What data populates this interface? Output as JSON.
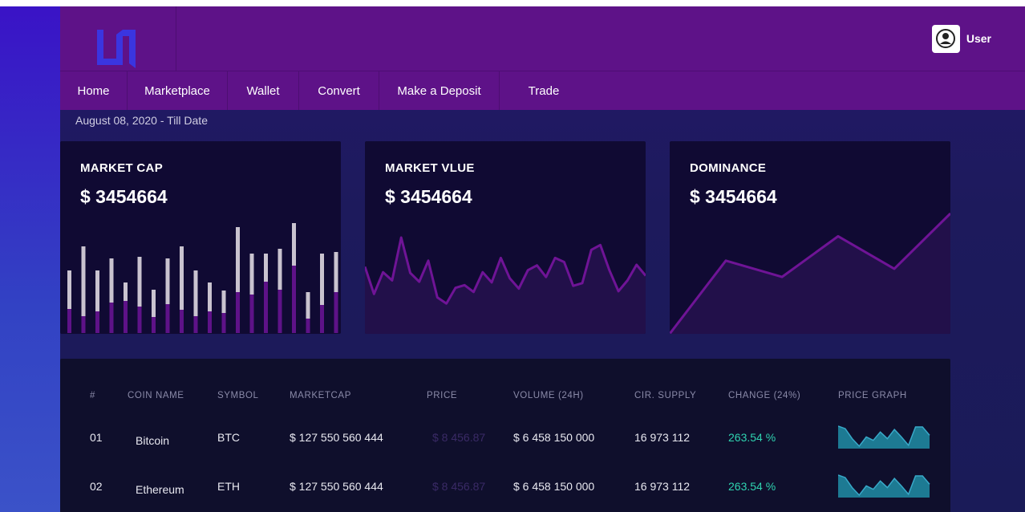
{
  "header": {
    "logo_icon": "brand-logo-icon",
    "user": {
      "name": "User",
      "avatar_icon": "user-avatar-icon"
    }
  },
  "nav": {
    "items": [
      {
        "label": "Home"
      },
      {
        "label": "Marketplace"
      },
      {
        "label": "Wallet"
      },
      {
        "label": "Convert"
      },
      {
        "label": "Make a Deposit"
      },
      {
        "label": "Trade"
      }
    ]
  },
  "date_range": "August 08, 2020 - Till Date",
  "cards": [
    {
      "title": "MARKET CAP",
      "value": "$ 3454664"
    },
    {
      "title": "MARKET VLUE",
      "value": "$ 3454664"
    },
    {
      "title": "DOMINANCE",
      "value": "$ 3454664"
    }
  ],
  "colors": {
    "header_bg": "#5e1288",
    "card_bg": "#100a33",
    "bar_light": "#c9c3cf",
    "bar_accent": "#5e1288",
    "line_accent": "#6f1496",
    "change_color": "#2fd3b0",
    "sparkline": "#1d7a93"
  },
  "chart_data": [
    {
      "type": "bar",
      "series": [
        {
          "values": [
            78,
            108,
            78,
            93,
            63,
            95,
            54,
            93,
            108,
            78,
            63,
            53,
            132,
            99,
            99,
            105,
            137,
            51,
            99,
            101
          ]
        },
        {
          "values": [
            30,
            21,
            27,
            38,
            40,
            33,
            20,
            36,
            29,
            21,
            27,
            25,
            51,
            48,
            64,
            54,
            84,
            18,
            35,
            51
          ]
        }
      ]
    },
    {
      "type": "area",
      "values": [
        75,
        35,
        67,
        55,
        118,
        66,
        53,
        84,
        30,
        21,
        44,
        48,
        38,
        67,
        52,
        88,
        58,
        43,
        70,
        77,
        60,
        88,
        82,
        47,
        51,
        100,
        107,
        70,
        39,
        55,
        78,
        62
      ]
    },
    {
      "type": "area",
      "values": [
        0,
        90,
        70,
        120,
        80,
        148
      ]
    }
  ],
  "table": {
    "headers": [
      "#",
      "COIN NAME",
      "SYMBOL",
      "MARKETCAP",
      "PRICE",
      "VOLUME (24H)",
      "CIR. SUPPLY",
      "CHANGE (24%)",
      "PRICE GRAPH"
    ],
    "rows": [
      {
        "num": "01",
        "name": "Bitcoin",
        "symbol": "BTC",
        "marketcap": "$ 127 550 560 444",
        "price": "$ 8 456.87",
        "volume": "$ 6 458 150 000",
        "supply": "16 973 112",
        "change": "263.54 %"
      },
      {
        "num": "02",
        "name": "Ethereum",
        "symbol": "ETH",
        "marketcap": "$ 127 550 560 444",
        "price": "$ 8 456.87",
        "volume": "$ 6 458 150 000",
        "supply": "16 973 112",
        "change": "263.54 %"
      }
    ],
    "sparkline": [
      25,
      22,
      10,
      1,
      12,
      8,
      18,
      10,
      21,
      12,
      2,
      24,
      24,
      14
    ]
  }
}
